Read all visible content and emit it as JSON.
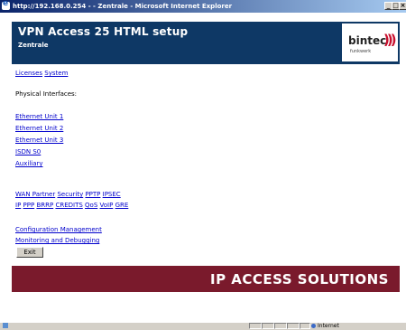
{
  "window": {
    "title": "http://192.168.0.254 - - Zentrale - Microsoft Internet Explorer",
    "min_glyph": "_",
    "max_glyph": "□",
    "close_glyph": "×"
  },
  "header": {
    "title": "VPN Access 25 HTML setup",
    "subtitle": "Zentrale",
    "logo_word": "bintec",
    "logo_mark": ")))",
    "logo_sub": "funkwerk"
  },
  "nav": {
    "licenses": "Licenses",
    "system": "System",
    "physical_label": "Physical Interfaces:",
    "interfaces": [
      "Ethernet Unit 1",
      "Ethernet Unit 2",
      "Ethernet Unit 3",
      "ISDN S0",
      "Auxiliary"
    ],
    "row1": [
      "WAN Partner",
      "Security",
      "PPTP",
      "IPSEC"
    ],
    "row2": [
      "IP",
      "PPP",
      "BRRP",
      "CREDITS",
      "QoS",
      "VoIP",
      "GRE"
    ],
    "config": "Configuration Management",
    "monitoring": "Monitoring and Debugging",
    "exit": "Exit"
  },
  "footer": {
    "text": "IP ACCESS SOLUTIONS"
  },
  "statusbar": {
    "zone": "Internet"
  },
  "colors": {
    "header_bg": "#0e3865",
    "footer_bg": "#7a1a2c",
    "link": "#0000cc"
  }
}
